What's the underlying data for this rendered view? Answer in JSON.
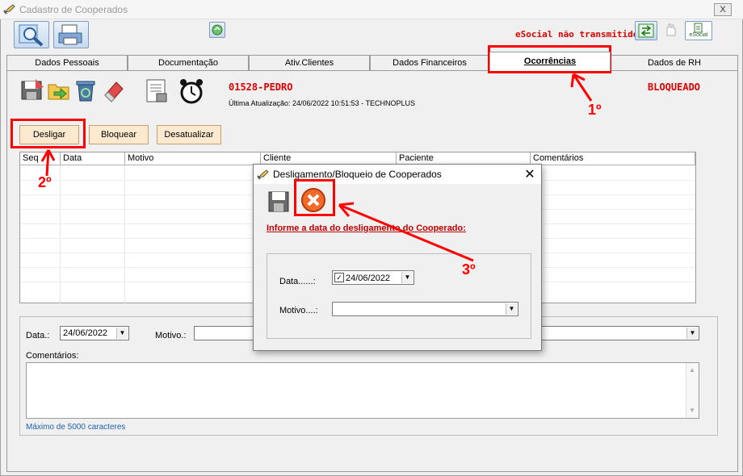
{
  "window": {
    "title": "Cadastro de Cooperados",
    "close_label": "X"
  },
  "toolbar": {
    "esocial_warning": "eSocial não transmitido",
    "esocial_label": "eSocial"
  },
  "tabs": [
    {
      "label": "Dados Pessoais"
    },
    {
      "label": "Documentação"
    },
    {
      "label": "Ativ.Clientes"
    },
    {
      "label": "Dados Financeiros"
    },
    {
      "label": "Ocorrências"
    },
    {
      "label": "Dados de RH"
    }
  ],
  "cooperado": {
    "name": "01528-PEDRO",
    "last_update": "Última Atualização: 24/06/2022 10:51:53 - TECHNOPLUS",
    "status": "BLOQUEADO"
  },
  "actions": {
    "desligar": "Desligar",
    "bloquear": "Bloquear",
    "desatualizar": "Desatualizar"
  },
  "grid": {
    "columns": [
      "Seq",
      "Data",
      "Motivo",
      "Cliente",
      "Paciente",
      "Comentários"
    ]
  },
  "detail": {
    "data_label": "Data.:",
    "data_value": "24/06/2022",
    "motivo_label": "Motivo.:",
    "comentarios_label": "Comentários:",
    "max_chars": "Máximo de 5000 caracteres"
  },
  "dialog": {
    "title": "Desligamento/Bloqueio de Cooperados",
    "close": "✕",
    "instruction": "Informe a data do desligamento do Cooperado:",
    "data_label": "Data......:",
    "data_value": "24/06/2022",
    "check": "✓",
    "motivo_label": "Motivo....:"
  },
  "annotations": {
    "step1": "1º",
    "step2": "2º",
    "step3": "3º"
  },
  "colors": {
    "alert_red": "#e00000",
    "annotation_red": "#ff0000",
    "button_bg": "#fde9d0",
    "link_blue": "#1f5fb0"
  }
}
